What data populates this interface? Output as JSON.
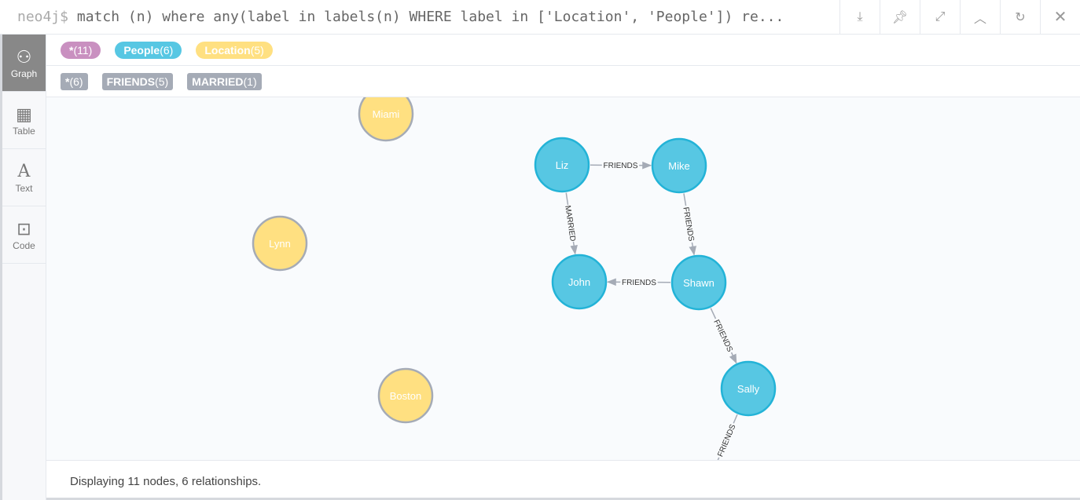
{
  "query": {
    "prompt": "neo4j$",
    "text": "match (n) where any(label in labels(n) WHERE label in ['Location', 'People']) re..."
  },
  "toolbar": [
    "download-icon",
    "pin-icon",
    "expand-icon",
    "collapse-icon",
    "refresh-icon",
    "close-icon"
  ],
  "sidebar": [
    {
      "label": "Graph",
      "icon": "graph-icon"
    },
    {
      "label": "Table",
      "icon": "table-icon"
    },
    {
      "label": "Text",
      "icon": "text-icon"
    },
    {
      "label": "Code",
      "icon": "code-icon"
    }
  ],
  "node_labels": [
    {
      "name": "*",
      "count": "(11)",
      "color": "#c990c0"
    },
    {
      "name": "People",
      "count": "(6)",
      "color": "#57c7e3"
    },
    {
      "name": "Location",
      "count": "(5)",
      "color": "#ffe081"
    }
  ],
  "rel_types": [
    {
      "name": "*",
      "count": "(6)"
    },
    {
      "name": "FRIENDS",
      "count": "(5)"
    },
    {
      "name": "MARRIED",
      "count": "(1)"
    }
  ],
  "graph": {
    "nodes": [
      {
        "id": "Miami",
        "label": "Location"
      },
      {
        "id": "Lynn",
        "label": "Location"
      },
      {
        "id": "Boston",
        "label": "Location"
      },
      {
        "id": "Liz",
        "label": "People"
      },
      {
        "id": "Mike",
        "label": "People"
      },
      {
        "id": "John",
        "label": "People"
      },
      {
        "id": "Shawn",
        "label": "People"
      },
      {
        "id": "Sally",
        "label": "People"
      }
    ],
    "edges": [
      {
        "from": "Liz",
        "to": "Mike",
        "type": "FRIENDS"
      },
      {
        "from": "Mike",
        "to": "Shawn",
        "type": "FRIENDS"
      },
      {
        "from": "Liz",
        "to": "John",
        "type": "MARRIED"
      },
      {
        "from": "Shawn",
        "to": "John",
        "type": "FRIENDS"
      },
      {
        "from": "Shawn",
        "to": "Sally",
        "type": "FRIENDS"
      },
      {
        "from": "Sally",
        "to": "",
        "type": "FRIENDS"
      }
    ]
  },
  "status": "Displaying 11 nodes, 6 relationships."
}
